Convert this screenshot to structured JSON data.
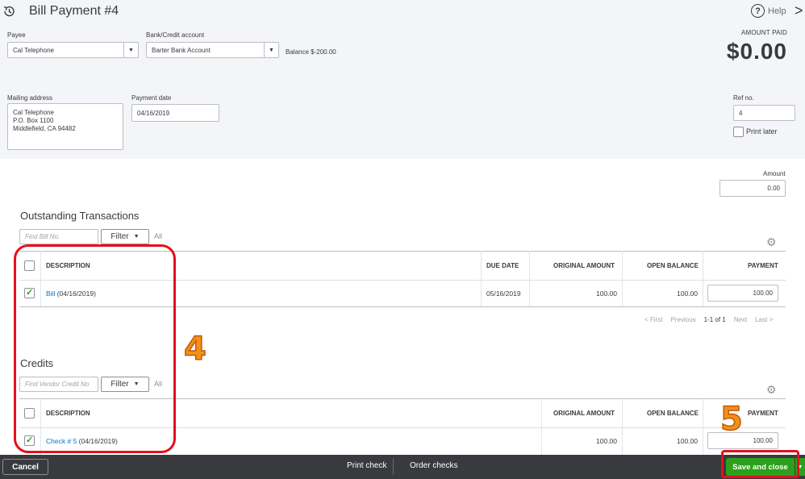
{
  "header": {
    "title": "Bill Payment  #4",
    "help_label": "Help",
    "close_glyph": ">"
  },
  "payee": {
    "label": "Payee",
    "value": "Cal Telephone"
  },
  "bank_account": {
    "label": "Bank/Credit account",
    "value": "Barter Bank Account",
    "balance": "Balance $-200.00"
  },
  "amount_paid": {
    "label": "AMOUNT PAID",
    "value": "$0.00"
  },
  "mailing_address": {
    "label": "Mailing address",
    "lines": [
      "Cal Telephone",
      "P.O. Box 1100",
      "Middlefield, CA  94482"
    ]
  },
  "payment_date": {
    "label": "Payment date",
    "value": "04/16/2019"
  },
  "ref_no": {
    "label": "Ref no.",
    "value": "4"
  },
  "print_later": {
    "label": "Print later",
    "checked": false
  },
  "amount": {
    "label": "Amount",
    "value": "0.00"
  },
  "outstanding": {
    "title": "Outstanding Transactions",
    "search_placeholder": "Find Bill No.",
    "filter_label": "Filter",
    "all_label": "All",
    "columns": [
      "DESCRIPTION",
      "DUE DATE",
      "ORIGINAL AMOUNT",
      "OPEN BALANCE",
      "PAYMENT"
    ],
    "rows": [
      {
        "checked": true,
        "desc_link": "Bill",
        "desc_rest": " (04/16/2019)",
        "due_date": "05/16/2019",
        "original": "100.00",
        "open": "100.00",
        "payment": "100.00"
      }
    ],
    "pager": {
      "first": "< First",
      "previous": "Previous",
      "range": "1-1 of 1",
      "next": "Next",
      "last": "Last >"
    }
  },
  "credits": {
    "title": "Credits",
    "search_placeholder": "Find Vendor Credit No",
    "filter_label": "Filter",
    "all_label": "All",
    "columns": [
      "DESCRIPTION",
      "ORIGINAL AMOUNT",
      "OPEN BALANCE",
      "PAYMENT"
    ],
    "rows": [
      {
        "checked": true,
        "desc_link": "Check # 5",
        "desc_rest": " (04/16/2019)",
        "original": "100.00",
        "open": "100.00",
        "payment": "100.00"
      }
    ]
  },
  "annotations": {
    "step4": "4",
    "step5": "5"
  },
  "footer": {
    "cancel_label": "Cancel",
    "print_check_label": "Print check",
    "order_checks_label": "Order checks",
    "save_close_label": "Save and close"
  },
  "colors": {
    "accent_green": "#2ca01c",
    "link_blue": "#0077c5",
    "annotation_red": "#e3101b",
    "annotation_orange": "#f39019",
    "footer_bg": "#393a3d"
  }
}
